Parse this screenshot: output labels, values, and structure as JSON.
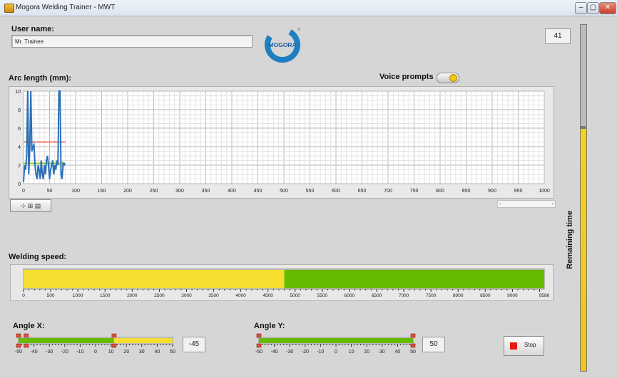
{
  "window": {
    "title": "Mogora Welding Trainer - MWT",
    "controls": [
      "–",
      "▢",
      "✕"
    ]
  },
  "user": {
    "label": "User name:",
    "value": "Mr. Trainee"
  },
  "logo": {
    "text": "MOGORA",
    "colors": {
      "ring": "#1f7fc0",
      "text": "#1f5fa8"
    }
  },
  "counter": "41",
  "voice_prompts": {
    "label": "Voice prompts",
    "on": true
  },
  "arc_length": {
    "label": "Arc length (mm):",
    "graph_tool_label": "⊹ ⊞ ▤",
    "scroll_arrows": [
      "‹",
      "›"
    ]
  },
  "welding_speed": {
    "label": "Welding speed:"
  },
  "remaining_time": {
    "label": "Remaining time",
    "level": 0.7
  },
  "angle_x": {
    "label": "Angle X:",
    "value": "-45"
  },
  "angle_y": {
    "label": "Angle Y:",
    "value": "50"
  },
  "stop_button": {
    "label": "Stop",
    "icon": "stop-icon"
  },
  "colors": {
    "yellow": "#f5de2f",
    "green": "#66bb00",
    "trace": "#2a6fb5",
    "limit_red": "#f07a6a",
    "limit_green": "#8ccf3a"
  },
  "chart_data": [
    {
      "type": "line",
      "xlim": [
        0,
        1000
      ],
      "ylim": [
        0,
        10
      ],
      "x_ticks": [
        0,
        50,
        100,
        150,
        200,
        250,
        300,
        350,
        400,
        450,
        500,
        550,
        600,
        650,
        700,
        750,
        800,
        850,
        900,
        950,
        1000
      ],
      "y_ticks": [
        0,
        2,
        4,
        6,
        8,
        10
      ],
      "grid": true,
      "series": [
        {
          "x": [
            0,
            2,
            4,
            6,
            8,
            10,
            12,
            14,
            16,
            18,
            20,
            22,
            24,
            26,
            28,
            30,
            32,
            34,
            36,
            38,
            40,
            42,
            44,
            46,
            48,
            50,
            52,
            54,
            56,
            58,
            60,
            62,
            64,
            66,
            68,
            70,
            72,
            74,
            76,
            78,
            80
          ],
          "y": [
            0.2,
            2.0,
            1.5,
            3.0,
            10,
            1.0,
            4.0,
            10,
            3.5,
            4.0,
            4.2,
            2.0,
            1.0,
            0.5,
            2.0,
            1.5,
            0.5,
            2.5,
            1.0,
            0.5,
            2.0,
            1.0,
            2.5,
            3.0,
            2.0,
            0.5,
            1.5,
            2.0,
            2.5,
            1.0,
            2.0,
            1.5,
            2.5,
            2.0,
            10,
            10,
            1.0,
            0.5,
            2.2,
            2.0,
            2.2
          ]
        }
      ],
      "reference_lines": [
        {
          "y": 4.5,
          "x_range": [
            0,
            80
          ],
          "color": "#f07a6a"
        },
        {
          "y": 2.2,
          "x_range": [
            0,
            80
          ],
          "color": "#8ccf3a"
        }
      ]
    },
    {
      "type": "bar",
      "xlim": [
        0,
        9586
      ],
      "x_ticks": [
        0,
        500,
        1000,
        1500,
        2000,
        2500,
        3000,
        3500,
        4000,
        4500,
        5000,
        5500,
        6000,
        6500,
        7000,
        7500,
        8000,
        8500,
        9000,
        9586
      ],
      "segments": [
        {
          "from": 0,
          "to": 4800,
          "color": "#f5de2f"
        },
        {
          "from": 4800,
          "to": 9586,
          "color": "#66bb00"
        }
      ]
    },
    {
      "type": "bar",
      "xlim": [
        -50,
        50
      ],
      "x_ticks": [
        -50,
        -40,
        -30,
        -20,
        -10,
        0,
        10,
        20,
        30,
        40,
        50
      ],
      "segments": [
        {
          "from": -50,
          "to": 12,
          "color": "#66bb00"
        },
        {
          "from": 12,
          "to": 50,
          "color": "#f5de2f"
        }
      ],
      "markers": [
        -50,
        -45,
        12
      ]
    },
    {
      "type": "bar",
      "xlim": [
        -50,
        50
      ],
      "x_ticks": [
        -50,
        -40,
        -30,
        -20,
        -10,
        0,
        10,
        20,
        30,
        40,
        50
      ],
      "segments": [
        {
          "from": -50,
          "to": 50,
          "color": "#66bb00"
        }
      ],
      "markers": [
        -50,
        50
      ]
    }
  ]
}
